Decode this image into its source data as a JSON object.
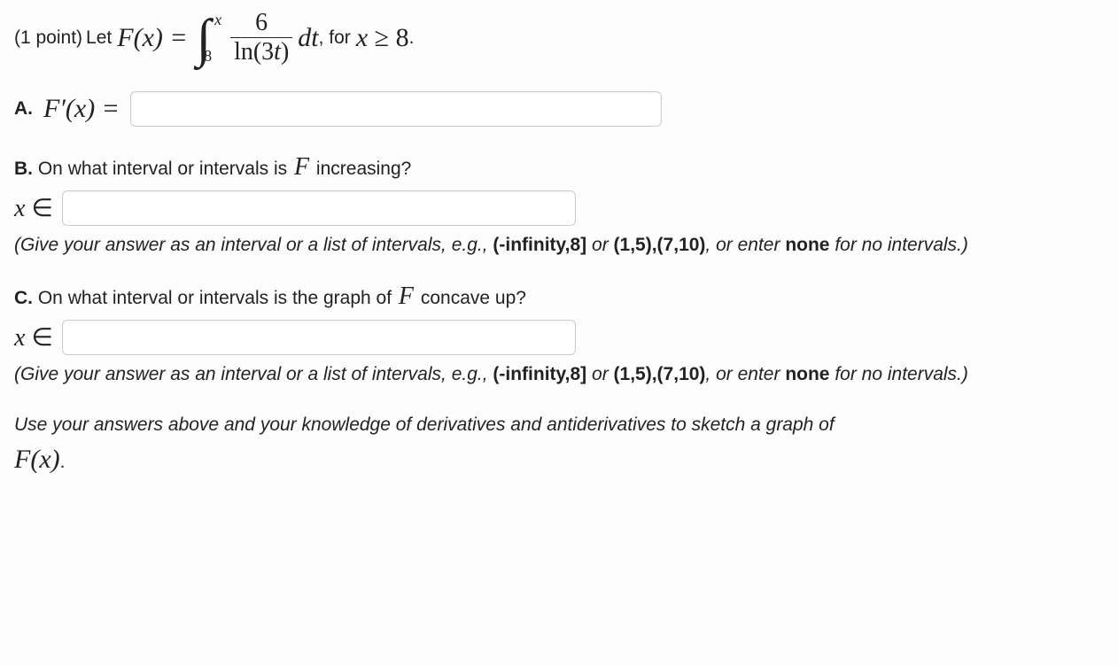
{
  "intro": {
    "points": "(1 point)",
    "let": "Let",
    "Fx": "F(x) =",
    "integral_upper": "x",
    "integral_lower": "8",
    "frac_num": "6",
    "frac_den": "ln(3t)",
    "dt": " dt",
    "for": ", for",
    "cond": "x ≥ 8",
    "period": "."
  },
  "partA": {
    "label": "A.",
    "expr": "F′(x) ="
  },
  "partB": {
    "label": "B.",
    "question": "On what interval or intervals is",
    "F": "F",
    "question2": "increasing?",
    "xin": "x ∈"
  },
  "hint": {
    "text1": "(Give your answer as an interval or a list of intervals, e.g.,",
    "ex1": "(-infinity,8]",
    "or1": "or",
    "ex2": "(1,5),(7,10)",
    "or2": ", or enter",
    "none": "none",
    "text2": "for no intervals.)"
  },
  "partC": {
    "label": "C.",
    "question": "On what interval or intervals is the graph of",
    "F": "F",
    "question2": "concave up?",
    "xin": "x ∈"
  },
  "final": {
    "text": "Use your answers above and your knowledge of derivatives and antiderivatives to sketch a graph of",
    "Fx": "F(x)",
    "period": "."
  }
}
